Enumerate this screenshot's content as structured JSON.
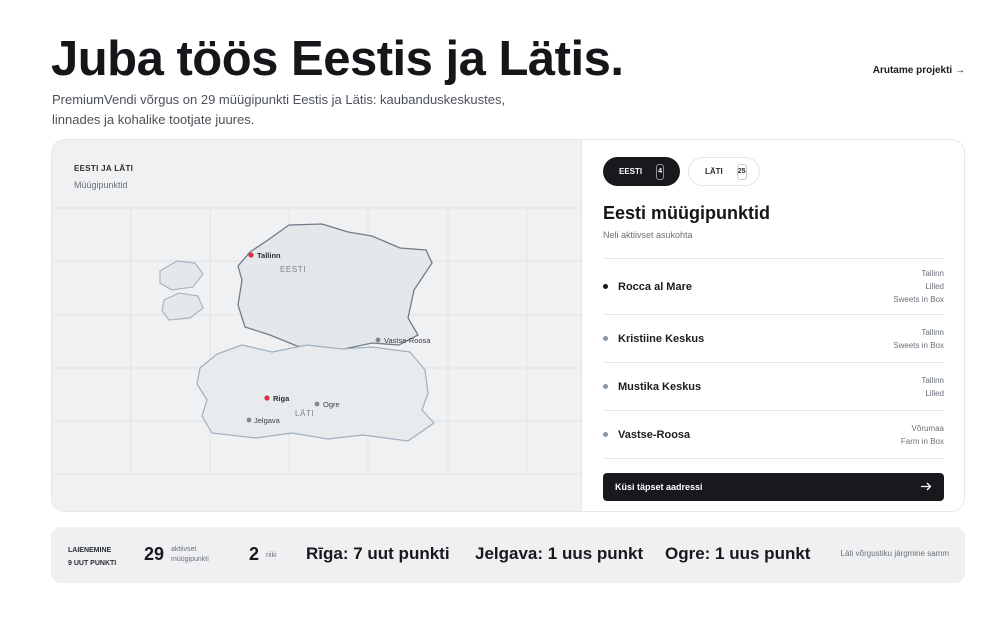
{
  "hero": {
    "title": "Juba töös Eestis ja Lätis.",
    "subtitle": "PremiumVendi võrgus on 29 müügipunkti Eestis ja Lätis: kaubanduskeskustes, linnades ja kohalike tootjate juures.",
    "cta": "Arutame projekti →"
  },
  "map": {
    "kicker": "EESTI JA LÄTI",
    "caption": "Müügipunktid",
    "regions": {
      "estonia": "EESTI",
      "latvia": "LÄTI"
    },
    "points": {
      "tallinn": "Tallinn",
      "vastse_roosa": "Vastse-Roosa",
      "riga": "Riga",
      "ogre": "Ogre",
      "jelgava": "Jelgava"
    },
    "colors": {
      "capital": "#d9323c",
      "point": "#7e8893",
      "land": "#e5e8eb",
      "border": "#6f7c89"
    }
  },
  "tabs": [
    {
      "label": "EESTI",
      "count": "4"
    },
    {
      "label": "LÄTI",
      "count": "25"
    }
  ],
  "list": {
    "title": "Eesti müügipunktid",
    "subtitle": "Neli aktiivset asukohta",
    "items": [
      {
        "name": "Rocca al Mare",
        "tags": [
          "Tallinn",
          "Lilled",
          "Sweets in Box"
        ]
      },
      {
        "name": "Kristiine Keskus",
        "tags": [
          "Tallinn",
          "Sweets in Box"
        ]
      },
      {
        "name": "Mustika Keskus",
        "tags": [
          "Tallinn",
          "Lilled"
        ]
      },
      {
        "name": "Vastse-Roosa",
        "tags": [
          "Võrumaa",
          "Farm in Box"
        ]
      }
    ],
    "button": "Küsi täpset aadressi",
    "button_icon": "arrow-right-icon"
  },
  "stats": {
    "kicker_1": "LAIENEMINE",
    "kicker_2": "9 UUT PUNKTI",
    "points_num": "29",
    "points_label_1": "aktiivset",
    "points_label_2": "müügipunkti",
    "countries_num": "2",
    "countries_label": "riiki",
    "riga": "Rīga: 7 uut punkti",
    "jelgava": "Jelgava: 1 uus punkt",
    "ogre": "Ogre: 1 uus punkt",
    "next": "Läti võrgustiku järgmine samm"
  }
}
